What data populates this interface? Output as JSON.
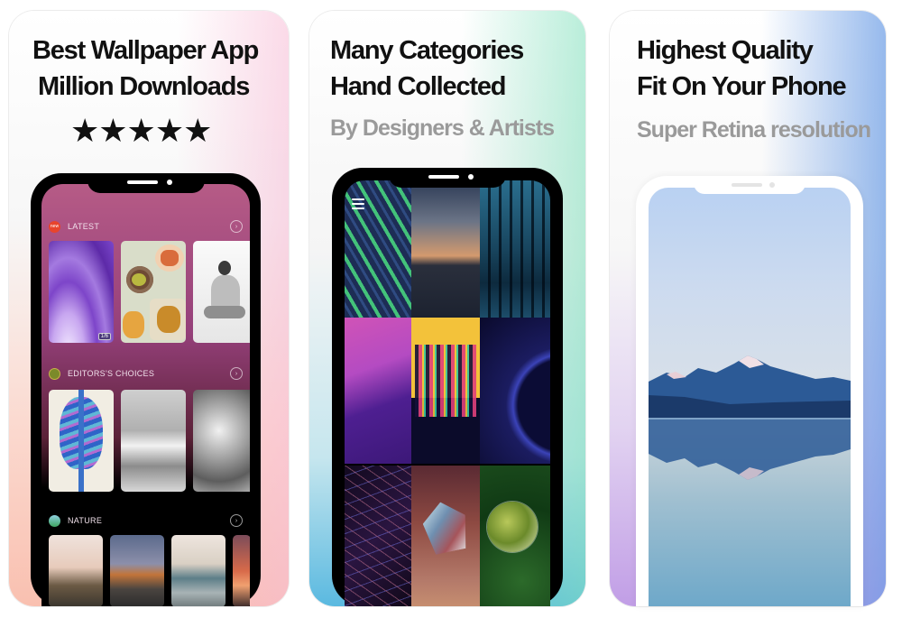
{
  "panels": [
    {
      "headline_lines": [
        "Best Wallpaper App",
        "Million Downloads"
      ],
      "rating": {
        "stars_filled": 5,
        "stars_total": 5,
        "glyphs": "★★★★★"
      },
      "phone": {
        "sections": [
          {
            "label": "LATEST",
            "icon": "latest-badge-icon",
            "icon_text": "new",
            "icon_color": "#e8442c",
            "arrow": "›"
          },
          {
            "label": "EDITORS'S CHOICES",
            "icon": "trophy-icon",
            "icon_text": "",
            "icon_color": "#7b8a2a",
            "arrow": "›"
          },
          {
            "label": "NATURE",
            "icon": "nature-globe-icon",
            "icon_text": "",
            "icon_color": "#4caf6e",
            "arrow": "›"
          }
        ],
        "thumb_badge": "1/6"
      }
    },
    {
      "headline_lines": [
        "Many Categories",
        "Hand Collected"
      ],
      "subline": "By Designers & Artists"
    },
    {
      "headline_lines": [
        "Highest Quality",
        "Fit On Your Phone"
      ],
      "subline": "Super Retina resolution"
    }
  ],
  "colors": {
    "panel1_accent": "#f9c0b0",
    "panel2_accent": "#5ab9e0",
    "panel3_accent": "#c19ee6",
    "headline": "#111111",
    "subline": "#9a9a9a"
  }
}
